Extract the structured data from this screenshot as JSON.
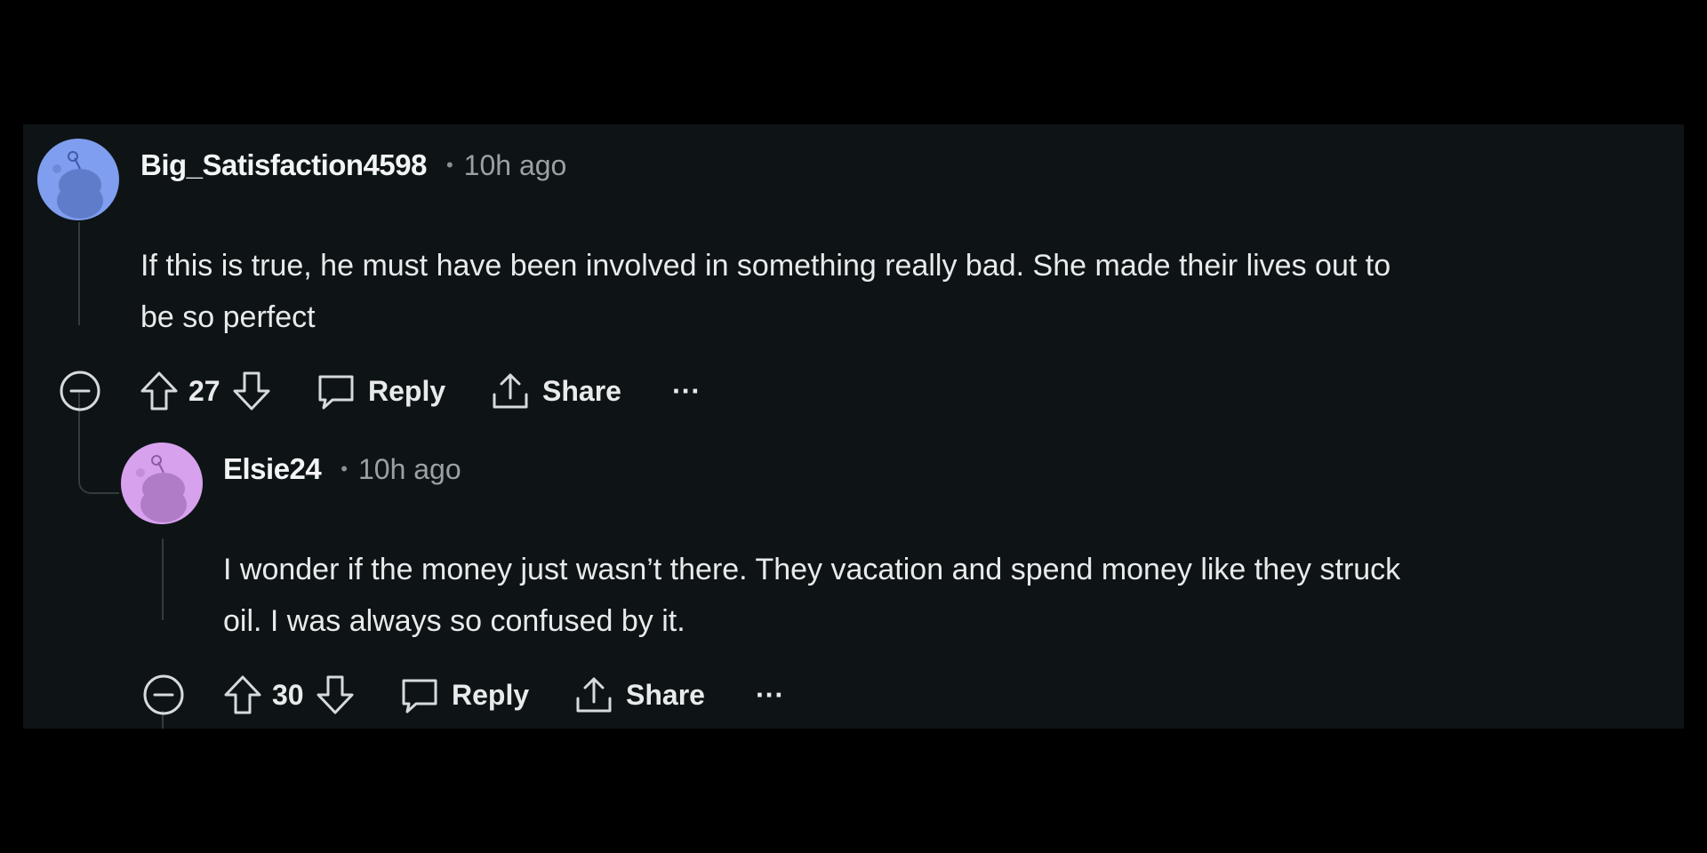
{
  "colors": {
    "background": "#000000",
    "panel": "#0e1416",
    "thread_line": "#343a3d",
    "avatar_1": "#7f9eef",
    "avatar_2": "#d8a1ee"
  },
  "comments": [
    {
      "username": "Big_Satisfaction4598",
      "separator": "•",
      "time": "10h ago",
      "body_line_1": "If this is true, he must have been involved in something really bad. She made their lives out to",
      "body_line_2": "be so perfect",
      "votes": "27",
      "reply_label": "Reply",
      "share_label": "Share",
      "more_label": "···",
      "icons": [
        "collapse-icon",
        "upvote-icon",
        "downvote-icon",
        "comment-bubble-icon",
        "share-icon",
        "more-icon"
      ]
    },
    {
      "username": "Elsie24",
      "separator": "•",
      "time": "10h ago",
      "body_line_1": "I wonder if the money just wasn’t there. They vacation and spend money like they struck",
      "body_line_2": "oil. I was always so confused by it.",
      "votes": "30",
      "reply_label": "Reply",
      "share_label": "Share",
      "more_label": "···",
      "icons": [
        "collapse-icon",
        "upvote-icon",
        "downvote-icon",
        "comment-bubble-icon",
        "share-icon",
        "more-icon"
      ]
    }
  ]
}
